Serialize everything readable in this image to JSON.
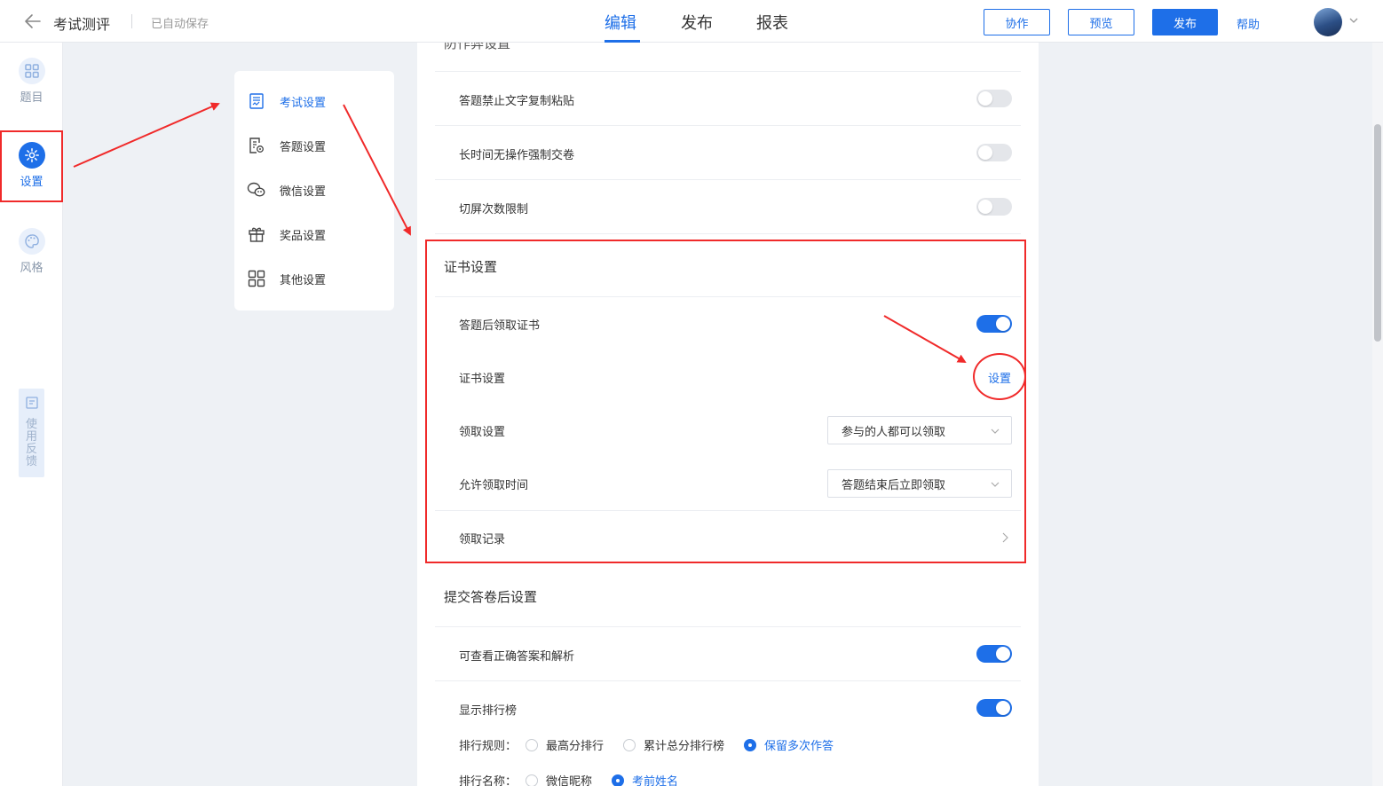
{
  "header": {
    "title": "考试测评",
    "saved_status": "已自动保存",
    "tabs": [
      {
        "label": "编辑",
        "active": true
      },
      {
        "label": "发布",
        "active": false
      },
      {
        "label": "报表",
        "active": false
      }
    ],
    "buttons": {
      "collaborate": "协作",
      "preview": "预览",
      "publish": "发布"
    },
    "help": "帮助"
  },
  "rail": {
    "items": [
      {
        "label": "题目",
        "icon": "grid-icon"
      },
      {
        "label": "设置",
        "icon": "gear-icon",
        "active": true
      },
      {
        "label": "风格",
        "icon": "palette-icon"
      }
    ],
    "feedback": [
      "使",
      "用",
      "反",
      "馈"
    ]
  },
  "menu": {
    "items": [
      {
        "label": "考试设置",
        "icon": "exam-doc-icon",
        "active": true
      },
      {
        "label": "答题设置",
        "icon": "answer-settings-icon"
      },
      {
        "label": "微信设置",
        "icon": "wechat-icon"
      },
      {
        "label": "奖品设置",
        "icon": "gift-icon"
      },
      {
        "label": "其他设置",
        "icon": "apps-icon"
      }
    ]
  },
  "panel": {
    "cut_title": "防作弊设置",
    "anti_cheat": [
      {
        "label": "答题禁止文字复制粘贴",
        "on": false
      },
      {
        "label": "长时间无操作强制交卷",
        "on": false
      },
      {
        "label": "切屏次数限制",
        "on": false
      }
    ],
    "certificate": {
      "title": "证书设置",
      "receive_after": {
        "label": "答题后领取证书",
        "on": true
      },
      "cert_setting": {
        "label": "证书设置",
        "link": "设置"
      },
      "receive_setting": {
        "label": "领取设置",
        "value": "参与的人都可以领取"
      },
      "receive_time": {
        "label": "允许领取时间",
        "value": "答题结束后立即领取"
      },
      "records": {
        "label": "领取记录"
      }
    },
    "after_submit": {
      "title": "提交答卷后设置",
      "view_answers": {
        "label": "可查看正确答案和解析",
        "on": true
      },
      "leaderboard": {
        "label": "显示排行榜",
        "on": true
      },
      "rank_rule": {
        "label": "排行规则：",
        "options": [
          "最高分排行",
          "累计总分排行榜",
          "保留多次作答"
        ],
        "selected": "保留多次作答"
      },
      "rank_name": {
        "label": "排行名称：",
        "options": [
          "微信昵称",
          "考前姓名"
        ],
        "selected": "考前姓名"
      }
    }
  },
  "colors": {
    "accent": "#1e6fe8",
    "annotation": "#f02a2a"
  }
}
